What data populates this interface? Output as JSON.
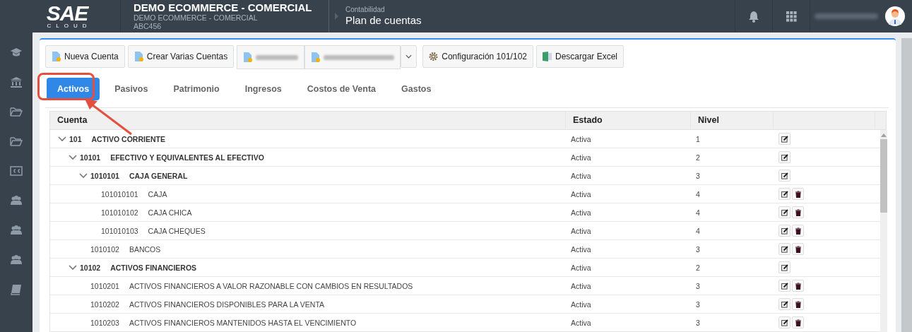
{
  "logo": {
    "mark": "SAE",
    "sub": "CLOUD"
  },
  "company": {
    "title": "DEMO ECOMMERCE - COMERCIAL",
    "subtitle": "DEMO ECOMMERCE - COMERCIAL",
    "code": "ABC456"
  },
  "breadcrumb": {
    "section": "Contabilidad",
    "page": "Plan de cuentas"
  },
  "toolbar": [
    {
      "kind": "doc",
      "label": "Nueva Cuenta"
    },
    {
      "kind": "doc",
      "label": "Crear Varias Cuentas"
    },
    {
      "kind": "doc-blurred"
    },
    {
      "kind": "doc-blurred"
    },
    {
      "kind": "caret"
    },
    {
      "kind": "gear",
      "label": "Configuración 101/102"
    },
    {
      "kind": "excel",
      "label": "Descargar Excel"
    }
  ],
  "tabs": [
    {
      "label": "Activos",
      "selected": true
    },
    {
      "label": "Pasivos",
      "selected": false
    },
    {
      "label": "Patrimonio",
      "selected": false
    },
    {
      "label": "Ingresos",
      "selected": false
    },
    {
      "label": "Costos de Venta",
      "selected": false
    },
    {
      "label": "Gastos",
      "selected": false
    }
  ],
  "table": {
    "columns": [
      "Cuenta",
      "Estado",
      "Nivel"
    ],
    "rows": [
      {
        "code": "101",
        "name": "ACTIVO CORRIENTE",
        "estado": "Activa",
        "nivel": "1",
        "expanded": true,
        "children": [
          {
            "code": "10101",
            "name": "EFECTIVO Y EQUIVALENTES AL EFECTIVO",
            "estado": "Activa",
            "nivel": "2",
            "expanded": true,
            "children": [
              {
                "code": "1010101",
                "name": "CAJA GENERAL",
                "estado": "Activa",
                "nivel": "3",
                "expanded": true,
                "children": [
                  {
                    "code": "101010101",
                    "name": "CAJA",
                    "estado": "Activa",
                    "nivel": "4"
                  },
                  {
                    "code": "101010102",
                    "name": "CAJA CHICA",
                    "estado": "Activa",
                    "nivel": "4"
                  },
                  {
                    "code": "101010103",
                    "name": "CAJA CHEQUES",
                    "estado": "Activa",
                    "nivel": "4"
                  }
                ]
              },
              {
                "code": "1010102",
                "name": "BANCOS",
                "estado": "Activa",
                "nivel": "3"
              }
            ]
          },
          {
            "code": "10102",
            "name": "ACTIVOS FINANCIEROS",
            "estado": "Activa",
            "nivel": "2",
            "expanded": true,
            "children": [
              {
                "code": "1010201",
                "name": "ACTIVOS FINANCIEROS A VALOR RAZONABLE CON CAMBIOS EN RESULTADOS",
                "estado": "Activa",
                "nivel": "3"
              },
              {
                "code": "1010202",
                "name": "ACTIVOS FINANCIEROS DISPONIBLES PARA LA VENTA",
                "estado": "Activa",
                "nivel": "3"
              },
              {
                "code": "1010203",
                "name": "ACTIVOS FINANCIEROS MANTENIDOS HASTA EL VENCIMIENTO",
                "estado": "Activa",
                "nivel": "3"
              }
            ]
          }
        ]
      }
    ]
  }
}
